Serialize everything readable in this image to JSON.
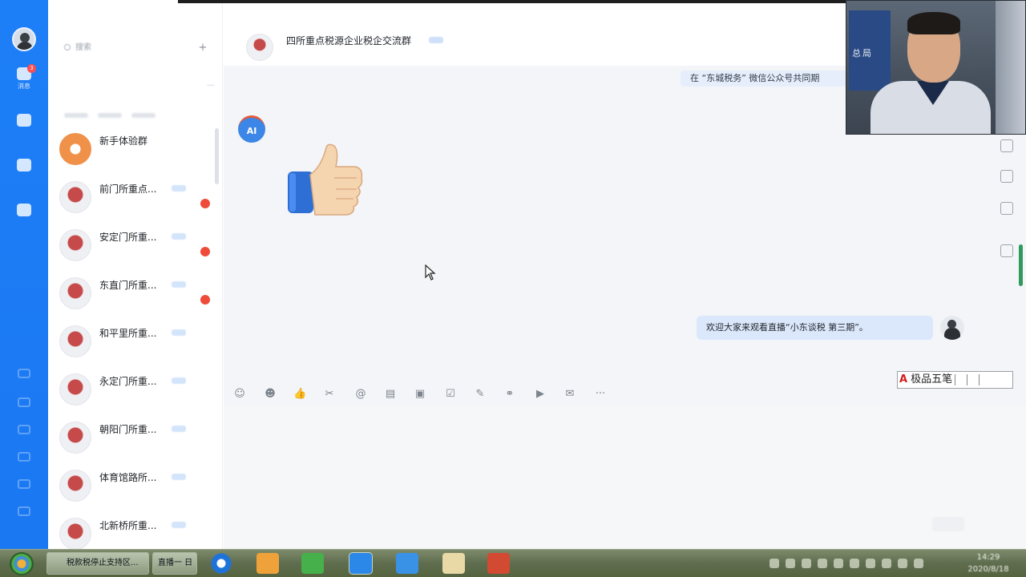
{
  "window": {
    "title": "四所重点税源企业税企交流群"
  },
  "rail": {
    "badge": "3",
    "items": [
      {
        "label": "消息",
        "icon": "chat-icon"
      },
      {
        "label": "",
        "icon": "contacts-icon"
      },
      {
        "label": "",
        "icon": "apps-icon"
      },
      {
        "label": "",
        "icon": "workbench-icon"
      }
    ]
  },
  "convlist": {
    "search_placeholder": "搜索",
    "plus": "+",
    "notice": "",
    "items": [
      {
        "name": "新手体验群",
        "preview": "",
        "avatar": "orange",
        "unread": false
      },
      {
        "name": "前门所重点...",
        "preview": "",
        "avatar": "red",
        "unread": true
      },
      {
        "name": "安定门所重...",
        "preview": "",
        "avatar": "red",
        "unread": true
      },
      {
        "name": "东直门所重...",
        "preview": "",
        "avatar": "red",
        "unread": true
      },
      {
        "name": "和平里所重...",
        "preview": "",
        "avatar": "red",
        "unread": false
      },
      {
        "name": "永定门所重...",
        "preview": "",
        "avatar": "red",
        "unread": false
      },
      {
        "name": "朝阳门所重...",
        "preview": "",
        "avatar": "red",
        "unread": false
      },
      {
        "name": "体育馆路所...",
        "preview": "",
        "avatar": "red",
        "unread": false
      },
      {
        "name": "北新桥所重...",
        "preview": "",
        "avatar": "red",
        "unread": false
      }
    ]
  },
  "chat": {
    "title": "四所重点税源企业税企交流群",
    "subtitle": "",
    "system_banner": "在 “东城税务” 微信公众号共同期",
    "ai_avatar": "AI",
    "self_message": "欢迎大家来观看直播“小东谈税 第三期”。",
    "system_lines": [
      "",
      ""
    ],
    "thumb_emoji": "👍"
  },
  "toolbar": {
    "more": "···",
    "ime_label": "极品五笔",
    "ime_logo": "A"
  },
  "video": {
    "sign_text": "总局"
  },
  "taskbar": {
    "buttons": [
      {
        "label": "税款税停止支持区..."
      },
      {
        "label": "直播一 日"
      }
    ],
    "clock_time": "14:29",
    "clock_date": "2020/8/18"
  },
  "colors": {
    "rail_blue": "#1d7ff7",
    "bubble_blue": "#dbe8fb",
    "unread_red": "#ee4b3a"
  }
}
